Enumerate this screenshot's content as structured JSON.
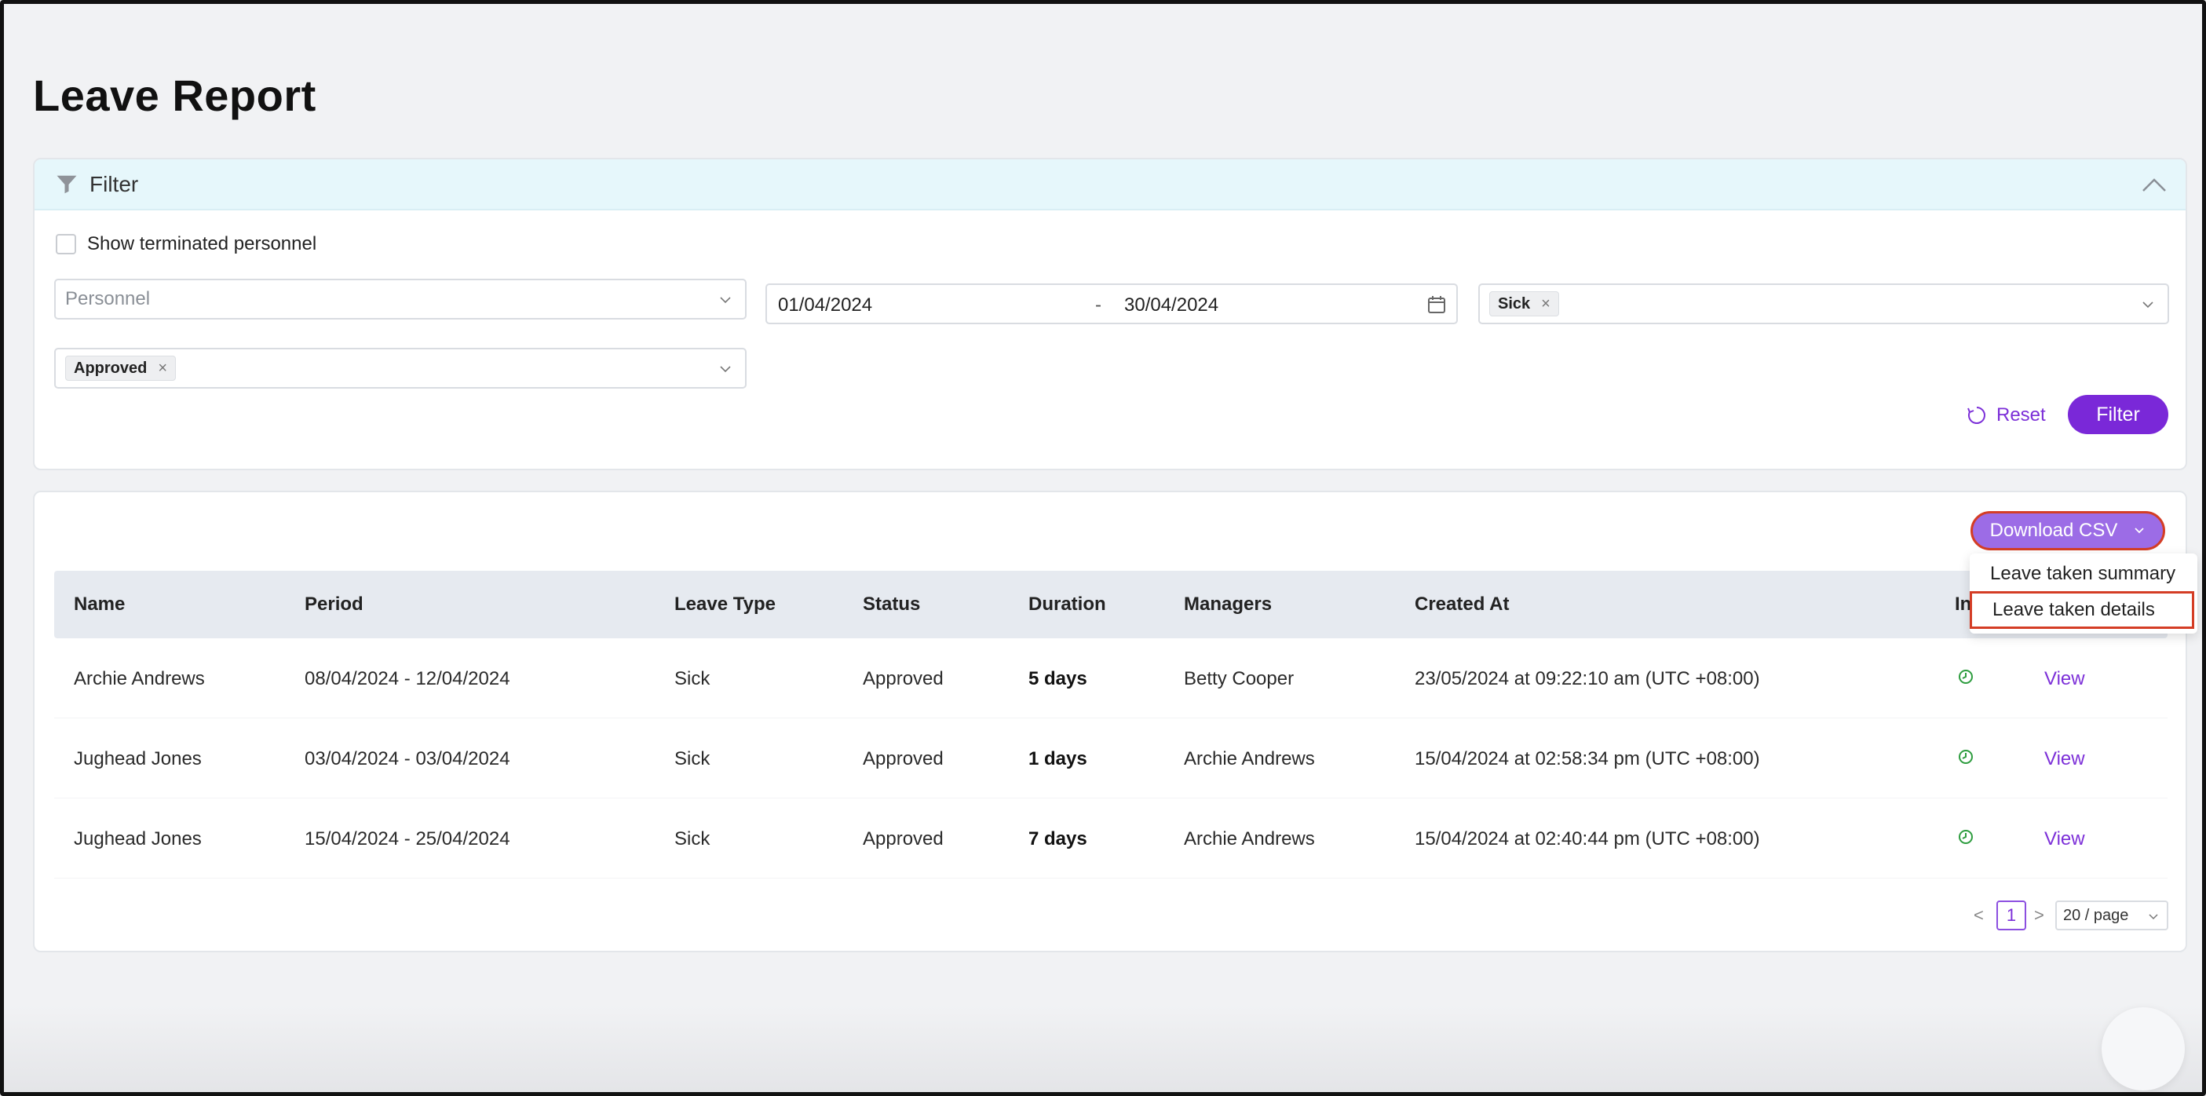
{
  "page": {
    "title": "Leave Report"
  },
  "filter": {
    "title": "Filter",
    "show_terminated_label": "Show terminated personnel",
    "personnel_placeholder": "Personnel",
    "date_from": "01/04/2024",
    "date_separator": "-",
    "date_to": "30/04/2024",
    "leave_type_tag": "Sick",
    "status_tag": "Approved",
    "reset_label": "Reset",
    "filter_label": "Filter",
    "tag_remove": "×"
  },
  "results": {
    "download_label": "Download CSV",
    "dropdown": {
      "items": [
        {
          "label": "Leave taken summary"
        },
        {
          "label": "Leave taken details"
        }
      ]
    },
    "columns": [
      "Name",
      "Period",
      "Leave Type",
      "Status",
      "Duration",
      "Managers",
      "Created At",
      "In"
    ],
    "rows": [
      {
        "name": "Archie Andrews",
        "period": "08/04/2024 - 12/04/2024",
        "leave_type": "Sick",
        "status": "Approved",
        "duration": "5 days",
        "managers": "Betty Cooper",
        "created_at": "23/05/2024 at 09:22:10 am (UTC +08:00)",
        "action": "View"
      },
      {
        "name": "Jughead Jones",
        "period": "03/04/2024 - 03/04/2024",
        "leave_type": "Sick",
        "status": "Approved",
        "duration": "1 days",
        "managers": "Archie Andrews",
        "created_at": "15/04/2024 at 02:58:34 pm (UTC +08:00)",
        "action": "View"
      },
      {
        "name": "Jughead Jones",
        "period": "15/04/2024 - 25/04/2024",
        "leave_type": "Sick",
        "status": "Approved",
        "duration": "7 days",
        "managers": "Archie Andrews",
        "created_at": "15/04/2024 at 02:40:44 pm (UTC +08:00)",
        "action": "View"
      }
    ],
    "pagination": {
      "prev": "<",
      "page": "1",
      "next": ">",
      "page_size": "20 / page"
    }
  },
  "colors": {
    "accent": "#7a28d8",
    "csv_button": "#9c6ce6",
    "highlight_border": "#d43d25",
    "status_icon": "#2e9d3f"
  },
  "icons": {
    "filter": "funnel-icon",
    "collapse": "chevron-up-icon",
    "calendar": "calendar-icon",
    "reset": "reset-icon",
    "status": "clock-check-icon"
  }
}
